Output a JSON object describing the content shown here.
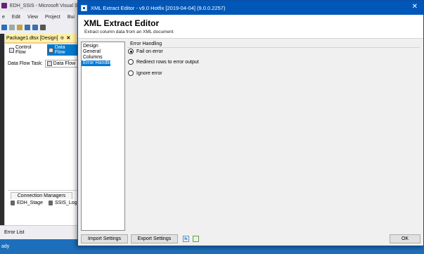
{
  "vs": {
    "title": "EDH_SSIS - Microsoft Visual Stu",
    "menu": [
      "e",
      "Edit",
      "View",
      "Project",
      "Bui"
    ],
    "doc_tab_label": "Package1.dtsx [Design]",
    "doc_tab_pin": "⊕",
    "doc_tab_close": "✕",
    "control_flow_label": "Control Flow",
    "data_flow_label": "Data Flow",
    "dft_label": "Data Flow Task:",
    "dft_value": "Data Flow",
    "conn_managers_label": "Connection Managers",
    "conn_items": [
      "EDH_Stage",
      "SSIS_Log"
    ],
    "error_list_label": "Error List",
    "status_text": "ady"
  },
  "dialog": {
    "title": "XML Extract Editor - v9.0 Hotfix [2019-04-04] (9.0.0.2257)",
    "close_glyph": "✕",
    "heading": "XML Extract Editor",
    "subheading": "Extract column data from an XML document",
    "nav_items": [
      {
        "label": "Design",
        "selected": false
      },
      {
        "label": "General",
        "selected": false
      },
      {
        "label": "Columns",
        "selected": false
      },
      {
        "label": "Error Handling",
        "selected": true
      }
    ],
    "group_title": "Error Handling",
    "radio_options": [
      {
        "label": "Fail on error",
        "checked": true
      },
      {
        "label": "Redirect rows to error output",
        "checked": false
      },
      {
        "label": "Ignore error",
        "checked": false
      }
    ],
    "import_button": "Import Settings",
    "export_button": "Export Settings",
    "fx_icon_glyph": "fx",
    "ok_button": "OK"
  },
  "colors": {
    "titlebar": "#0057b8",
    "selection": "#0078d7",
    "statusbar": "#1e6fbb"
  }
}
